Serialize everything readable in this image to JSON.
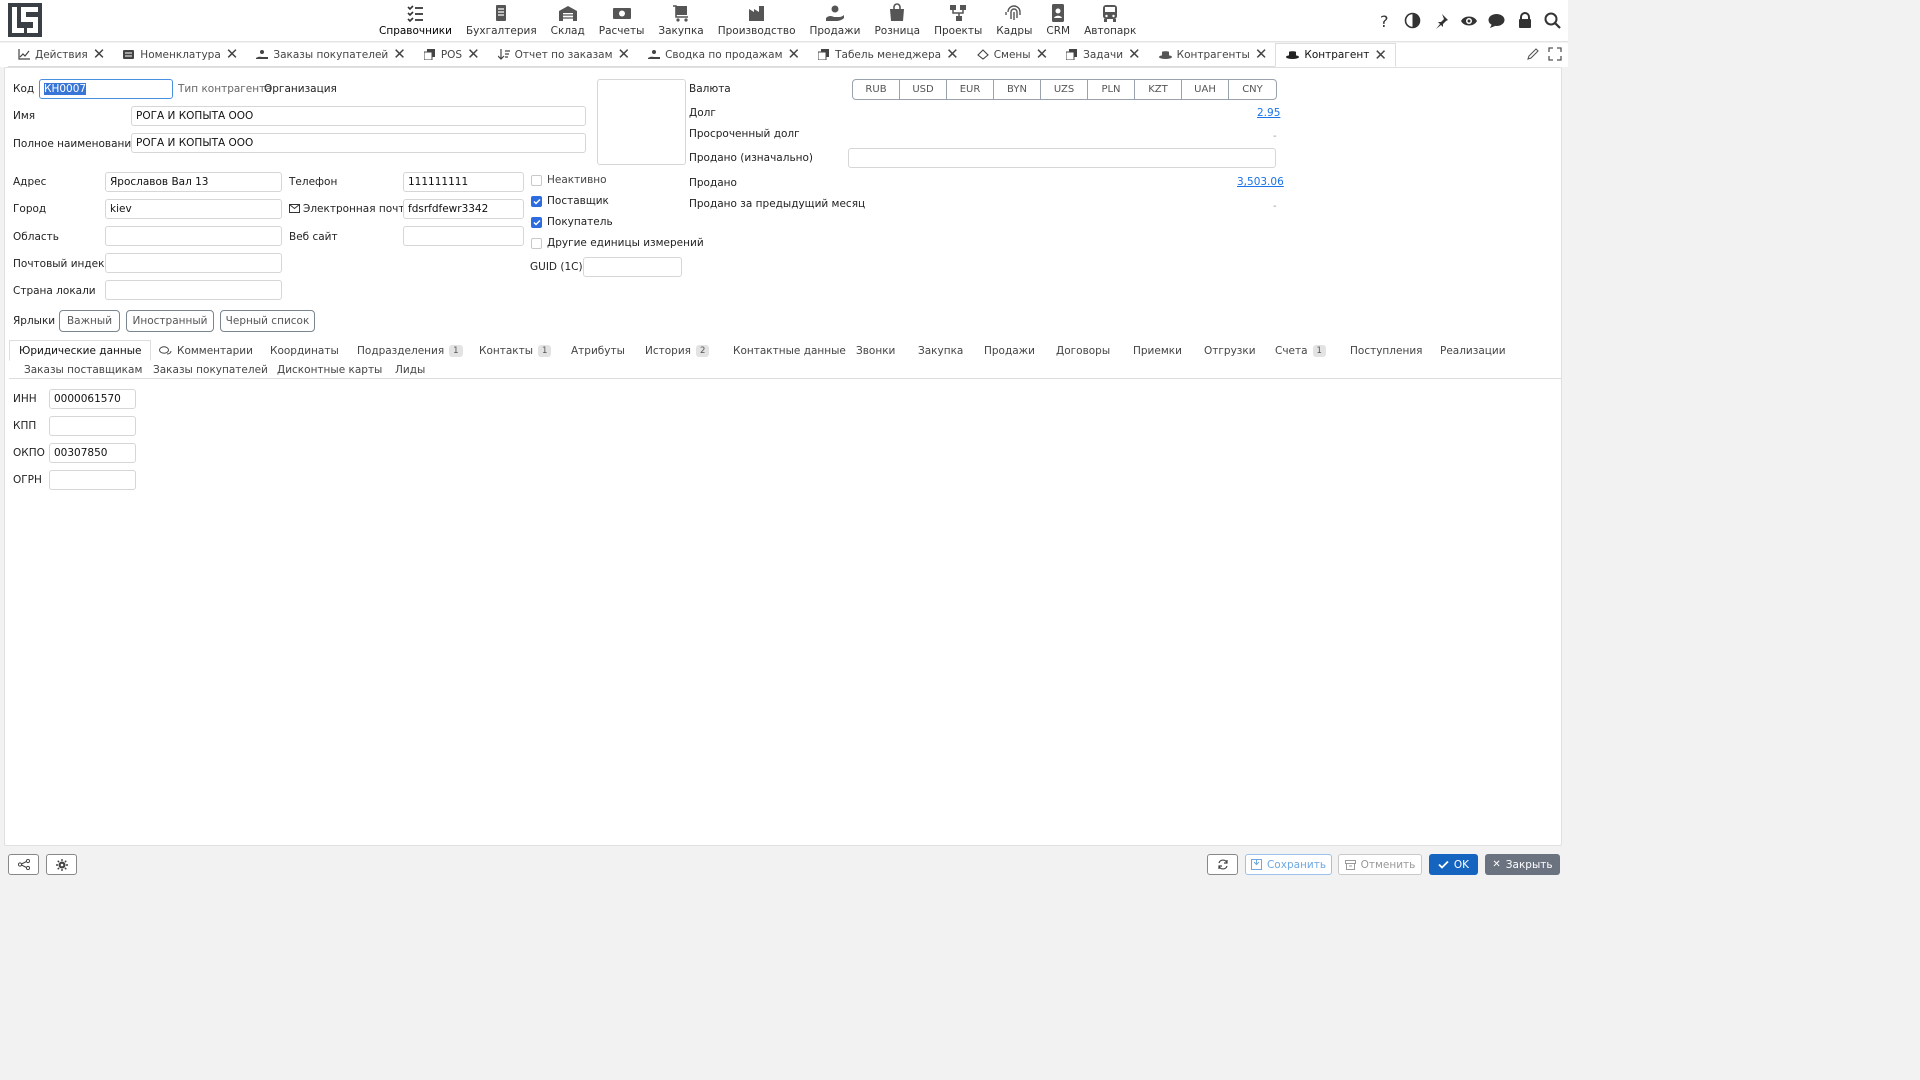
{
  "app": {
    "logo_text": "LS"
  },
  "menu": [
    {
      "label": "Справочники",
      "icon": "checklist-icon",
      "active": true
    },
    {
      "label": "Бухгалтерия",
      "icon": "ledger-icon"
    },
    {
      "label": "Склад",
      "icon": "warehouse-icon"
    },
    {
      "label": "Расчеты",
      "icon": "money-icon"
    },
    {
      "label": "Закупка",
      "icon": "cart-icon"
    },
    {
      "label": "Производство",
      "icon": "factory-icon"
    },
    {
      "label": "Продажи",
      "icon": "hand-coin-icon"
    },
    {
      "label": "Розница",
      "icon": "bag-icon"
    },
    {
      "label": "Проекты",
      "icon": "hierarchy-icon"
    },
    {
      "label": "Кадры",
      "icon": "fingerprint-icon"
    },
    {
      "label": "CRM",
      "icon": "contact-card-icon"
    },
    {
      "label": "Автопарк",
      "icon": "bus-icon"
    }
  ],
  "tabs": [
    {
      "label": "Действия",
      "icon": "chart-icon"
    },
    {
      "label": "Номенклатура",
      "icon": "list-icon"
    },
    {
      "label": "Заказы покупателей",
      "icon": "order-icon"
    },
    {
      "label": "POS",
      "icon": "copy-icon"
    },
    {
      "label": "Отчет по заказам",
      "icon": "sort-icon"
    },
    {
      "label": "Сводка по продажам",
      "icon": "order-icon"
    },
    {
      "label": "Табель менеджера",
      "icon": "copy-icon"
    },
    {
      "label": "Смены",
      "icon": "shift-icon"
    },
    {
      "label": "Задачи",
      "icon": "copy-icon"
    },
    {
      "label": "Контрагенты",
      "icon": "hat-icon"
    },
    {
      "label": "Контрагент",
      "icon": "hat-icon",
      "active": true
    }
  ],
  "form": {
    "code_label": "Код",
    "code_value": "КН0007",
    "type_label": "Тип контрагента",
    "type_value": "Организация",
    "name_label": "Имя",
    "name_value": "РОГА И КОПЫТА ООО",
    "fullname_label": "Полное наименование",
    "fullname_value": "РОГА И КОПЫТА ООО",
    "address_label": "Адрес",
    "address_value": "Ярославов Вал 13",
    "city_label": "Город",
    "city_value": "kiev",
    "region_label": "Область",
    "region_value": "",
    "zip_label": "Почтовый индекс",
    "zip_value": "",
    "country_label": "Страна локали",
    "country_value": "",
    "phone_label": "Телефон",
    "phone_value": "111111111",
    "email_label": "Электронная почта",
    "email_value": "fdsrfdfewr3342",
    "website_label": "Веб сайт",
    "website_value": "",
    "inactive_label": "Неактивно",
    "supplier_label": "Поставщик",
    "buyer_label": "Покупатель",
    "units_label": "Другие единицы измерений",
    "guid_label": "GUID (1C)",
    "guid_value": "",
    "checkboxes": {
      "inactive": false,
      "supplier": true,
      "buyer": true,
      "units": false
    }
  },
  "finance": {
    "currency_label": "Валюта",
    "currencies": [
      "RUB",
      "USD",
      "EUR",
      "BYN",
      "UZS",
      "PLN",
      "KZT",
      "UAH",
      "CNY"
    ],
    "debt_label": "Долг",
    "debt_value": "2.95",
    "overdue_label": "Просроченный долг",
    "overdue_value": "-",
    "sold_initial_label": "Продано (изначально)",
    "sold_initial_value": "",
    "sold_label": "Продано",
    "sold_value": "3,503.06",
    "sold_prev_label": "Продано за предыдущий месяц",
    "sold_prev_value": "-"
  },
  "tags": {
    "label": "Ярлыки",
    "items": [
      "Важный",
      "Иностранный",
      "Черный список"
    ]
  },
  "subtabs": {
    "row1": [
      {
        "label": "Юридические данные",
        "active": true
      },
      {
        "label": "Комментарии",
        "icon": "comments-icon"
      },
      {
        "label": "Координаты"
      },
      {
        "label": "Подразделения",
        "badge": "1"
      },
      {
        "label": "Контакты",
        "badge": "1"
      },
      {
        "label": "Атрибуты"
      },
      {
        "label": "История",
        "badge": "2"
      },
      {
        "label": "Контактные данные"
      },
      {
        "label": "Звонки"
      },
      {
        "label": "Закупка"
      },
      {
        "label": "Продажи"
      },
      {
        "label": "Договоры"
      },
      {
        "label": "Приемки"
      },
      {
        "label": "Отгрузки"
      },
      {
        "label": "Счета",
        "badge": "1"
      },
      {
        "label": "Поступления"
      },
      {
        "label": "Реализации"
      }
    ],
    "row2": [
      {
        "label": "Заказы поставщикам"
      },
      {
        "label": "Заказы покупателей"
      },
      {
        "label": "Дисконтные карты"
      },
      {
        "label": "Лиды"
      }
    ]
  },
  "legal": {
    "inn_label": "ИНН",
    "inn_value": "0000061570",
    "kpp_label": "КПП",
    "kpp_value": "",
    "okpo_label": "ОКПО",
    "okpo_value": "00307850",
    "ogrn_label": "ОГРН",
    "ogrn_value": ""
  },
  "footer": {
    "save_label": "Сохранить",
    "cancel_label": "Отменить",
    "ok_label": "OK",
    "close_label": "Закрыть",
    "colors": {
      "ok": "#1565c0",
      "close": "#6b7280",
      "save": "#6ea8e0"
    }
  }
}
